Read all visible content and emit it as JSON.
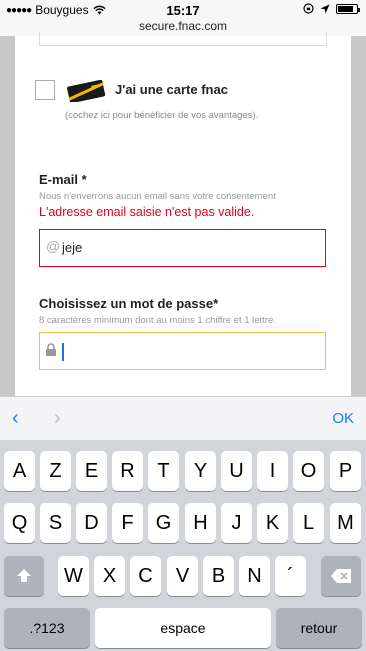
{
  "status_bar": {
    "signal": "●●●●●",
    "carrier": "Bouygues",
    "wifi_icon": "wifi-icon",
    "time": "15:17",
    "right_icons": [
      "rotation-lock-icon",
      "location-arrow-icon",
      "battery-icon"
    ],
    "url": "secure.fnac.com"
  },
  "fnac_card": {
    "label": "J'ai une carte fnac",
    "hint": "(cochez ici pour bénéficier de vos avantages)."
  },
  "email": {
    "label": "E-mail *",
    "note": "Nous n'enverrons aucun email sans votre consentement",
    "error": "L'adresse email saisie n'est pas valide.",
    "value": "jeje",
    "error_color": "#e2001a"
  },
  "password": {
    "label": "Choisissez un mot de passe*",
    "note": "8 caractères minimum dont au moins 1 chiffre et 1 lettre.",
    "focus_color": "#f5c33b"
  },
  "accessory": {
    "prev_icon": "chevron-left-icon",
    "next_icon": "chevron-right-icon",
    "ok": "OK"
  },
  "keyboard": {
    "row1": [
      "A",
      "Z",
      "E",
      "R",
      "T",
      "Y",
      "U",
      "I",
      "O",
      "P"
    ],
    "row2": [
      "Q",
      "S",
      "D",
      "F",
      "G",
      "H",
      "J",
      "K",
      "L",
      "M"
    ],
    "row3": [
      "W",
      "X",
      "C",
      "V",
      "B",
      "N",
      "´"
    ],
    "numbers": ".?123",
    "space": "espace",
    "return": "retour"
  }
}
